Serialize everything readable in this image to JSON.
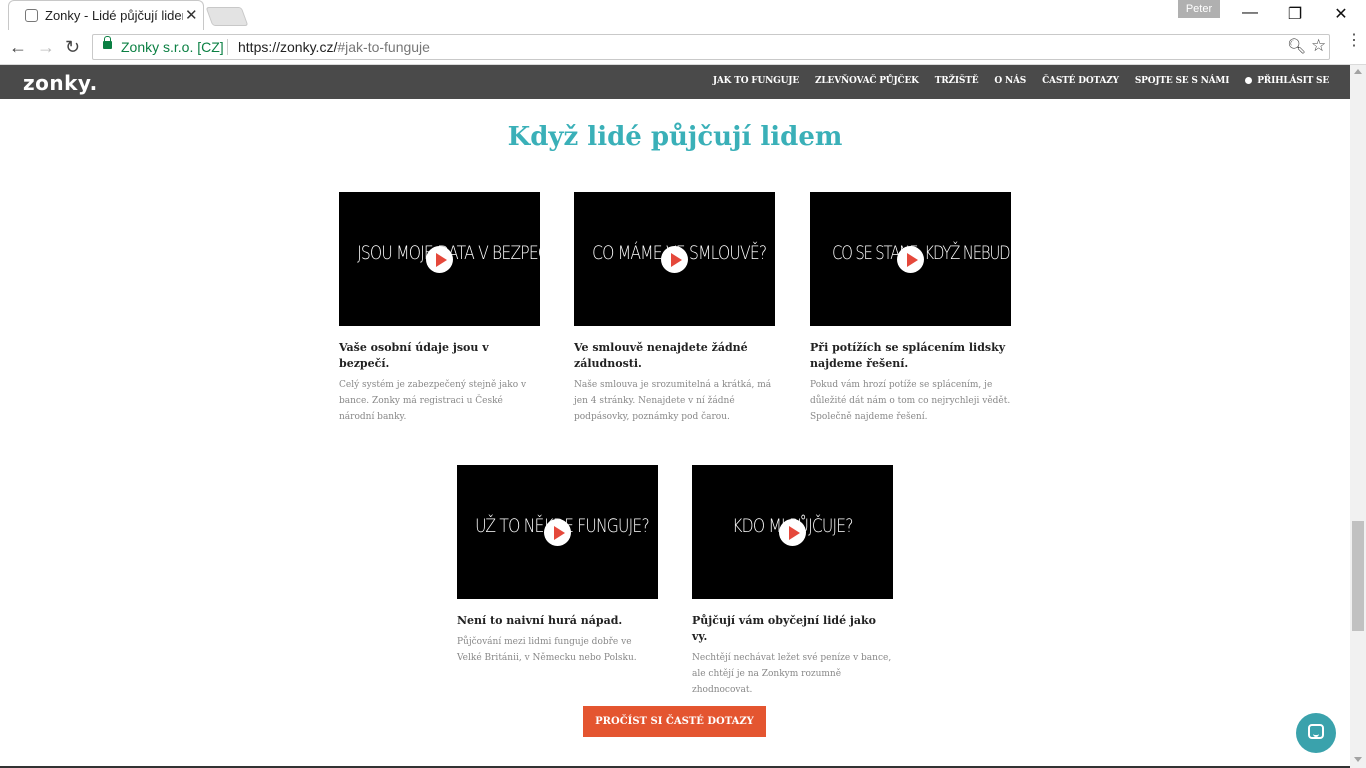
{
  "browser": {
    "tab_title": "Zonky - Lidé půjčují liden",
    "user": "Peter",
    "site_identity": "Zonky s.r.o. [CZ]",
    "url_host": "https://zonky.cz/",
    "url_path": "#jak-to-funguje"
  },
  "site": {
    "logo": "zonky.",
    "nav": [
      {
        "label": "JAK TO FUNGUJE"
      },
      {
        "label": "ZLEVŇOVAČ PŮJČEK"
      },
      {
        "label": "TRŽIŠTĚ"
      },
      {
        "label": "O NÁS"
      },
      {
        "label": "ČASTÉ DOTAZY"
      },
      {
        "label": "SPOJTE SE S NÁMI"
      },
      {
        "label": "PŘIHLÁSIT SE",
        "icon": "user-icon"
      }
    ]
  },
  "section": {
    "title": "Když lidé půjčují lidem",
    "cards": [
      {
        "video_text": "JSOU MOJE DATA V BEZPEČÍ?",
        "title": "Vaše osobní údaje jsou v bezpečí.",
        "text": "Celý systém je zabezpečený stejně jako v bance. Zonky má registraci u České národní banky."
      },
      {
        "video_text": "CO MÁME VE SMLOUVĚ?",
        "title": "Ve smlouvě nenajdete žádné záludnosti.",
        "text": "Naše smlouva je srozumitelná a krátká, má jen 4 stránky. Nenajdete v ní žádné podpásovky, poznámky pod čarou."
      },
      {
        "video_text": "CO SE STANE, KDYŽ NEBUDU SPLÁCET?",
        "title": "Při potížích se splácením lidsky najdeme řešení.",
        "text": "Pokud vám hrozí potíže se splácením, je důležité dát nám o tom co nejrychleji vědět. Společně najdeme řešení."
      },
      {
        "video_text": "UŽ TO NĚKDE FUNGUJE?",
        "title": "Není to naivní hurá nápad.",
        "text": "Půjčování mezi lidmi funguje dobře ve Velké Británii, v Německu nebo Polsku."
      },
      {
        "video_text": "KDO MI PŮJČUJE?",
        "title": "Půjčují vám obyčejní lidé jako vy.",
        "text": "Nechtějí nechávat ležet své peníze v bance, ale chtějí je na Zonkym rozumně zhodnocovat."
      }
    ],
    "cta_label": "PROČÍST SI ČASTÉ DOTAZY"
  },
  "colors": {
    "accent": "#3ab0b8",
    "cta": "#e45530",
    "header_bg": "#4a4a4a",
    "play": "#e5483b"
  }
}
